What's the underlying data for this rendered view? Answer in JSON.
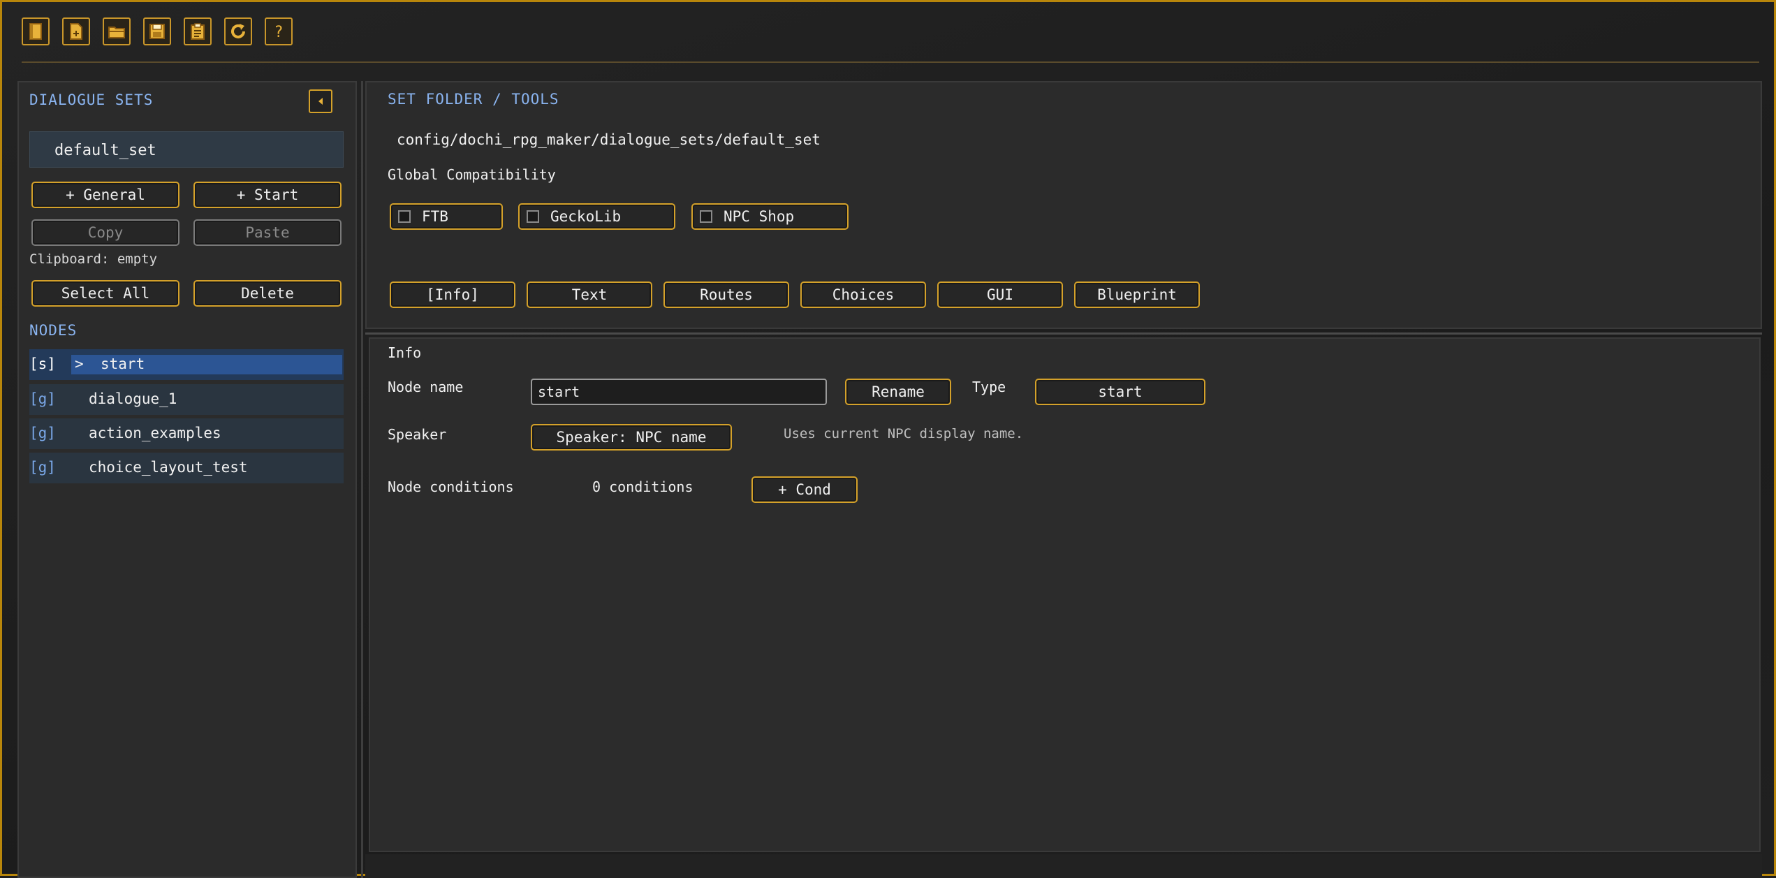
{
  "toolbar": {
    "buttons": [
      {
        "name": "book-icon"
      },
      {
        "name": "new-file-icon"
      },
      {
        "name": "open-folder-icon"
      },
      {
        "name": "save-icon"
      },
      {
        "name": "clipboard-icon"
      },
      {
        "name": "refresh-icon"
      },
      {
        "name": "help-icon",
        "glyph": "?"
      }
    ]
  },
  "sidebar": {
    "dialogue_sets_title": "DIALOGUE SETS",
    "collapse_icon": "chevron-left-icon",
    "selected_set": "default_set",
    "add_general": "+ General",
    "add_start": "+ Start",
    "copy": "Copy",
    "paste": "Paste",
    "clipboard_status": "Clipboard: empty",
    "select_all": "Select All",
    "delete": "Delete",
    "nodes_title": "NODES",
    "nodes": [
      {
        "tag": "[s]",
        "arrow": ">",
        "label": "start",
        "selected": true
      },
      {
        "tag": "[g]",
        "label": "dialogue_1"
      },
      {
        "tag": "[g]",
        "label": "action_examples"
      },
      {
        "tag": "[g]",
        "label": "choice_layout_test"
      }
    ]
  },
  "set_panel": {
    "title": "SET FOLDER / TOOLS",
    "path": "config/dochi_rpg_maker/dialogue_sets/default_set",
    "compat_label": "Global Compatibility",
    "compat": [
      {
        "label": "FTB",
        "checked": false
      },
      {
        "label": "GeckoLib",
        "checked": false
      },
      {
        "label": "NPC Shop",
        "checked": false
      }
    ],
    "tabs": [
      "[Info]",
      "Text",
      "Routes",
      "Choices",
      "GUI",
      "Blueprint"
    ]
  },
  "info": {
    "title": "Info",
    "node_name_label": "Node name",
    "node_name_value": "start",
    "rename": "Rename",
    "type_label": "Type",
    "type_value": "start",
    "speaker_label": "Speaker",
    "speaker_button": "Speaker: NPC name",
    "speaker_hint": "Uses current NPC display name.",
    "conditions_label": "Node conditions",
    "conditions_count": "0 conditions",
    "add_cond": "+ Cond"
  },
  "colors": {
    "accent_gold": "#d4a12a",
    "section_blue": "#8ab4f0",
    "selected_row": "#2c5594"
  }
}
